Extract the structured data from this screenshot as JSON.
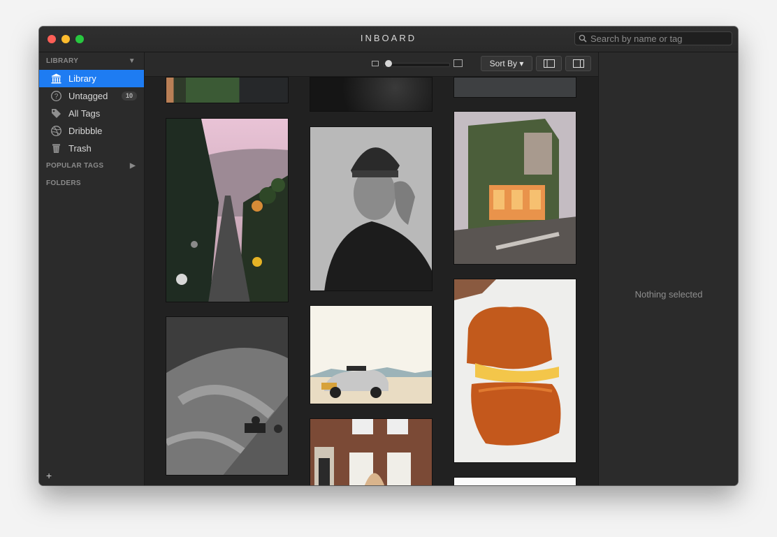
{
  "window": {
    "title": "INBOARD"
  },
  "search": {
    "placeholder": "Search by name or tag"
  },
  "sidebar": {
    "library_header": "LIBRARY",
    "items": [
      {
        "label": "Library",
        "icon": "library-icon",
        "selected": true
      },
      {
        "label": "Untagged",
        "icon": "question-icon",
        "count": "10"
      },
      {
        "label": "All Tags",
        "icon": "tag-icon"
      },
      {
        "label": "Dribbble",
        "icon": "dribbble-icon"
      },
      {
        "label": "Trash",
        "icon": "trash-icon"
      }
    ],
    "popular_tags_header": "POPULAR TAGS",
    "folders_header": "FOLDERS",
    "add_label": "+"
  },
  "toolbar": {
    "sort_label": "Sort By ▾",
    "zoom_level": 0.05
  },
  "photos": [
    {
      "subject": "city-street-partial"
    },
    {
      "subject": "night-sky-partial"
    },
    {
      "subject": "gray-partial"
    },
    {
      "subject": "palm-tree-street"
    },
    {
      "subject": "man-in-beanie-portrait"
    },
    {
      "subject": "ivy-covered-cafe"
    },
    {
      "subject": "people-on-stairs-bw"
    },
    {
      "subject": "rally-car-on-beach"
    },
    {
      "subject": "grilled-cheese-sandwich"
    },
    {
      "subject": "brick-townhouse"
    },
    {
      "subject": "white-partial"
    }
  ],
  "inspector": {
    "empty_text": "Nothing selected"
  },
  "colors": {
    "accent": "#1e7cf2",
    "window_bg": "#262626"
  }
}
